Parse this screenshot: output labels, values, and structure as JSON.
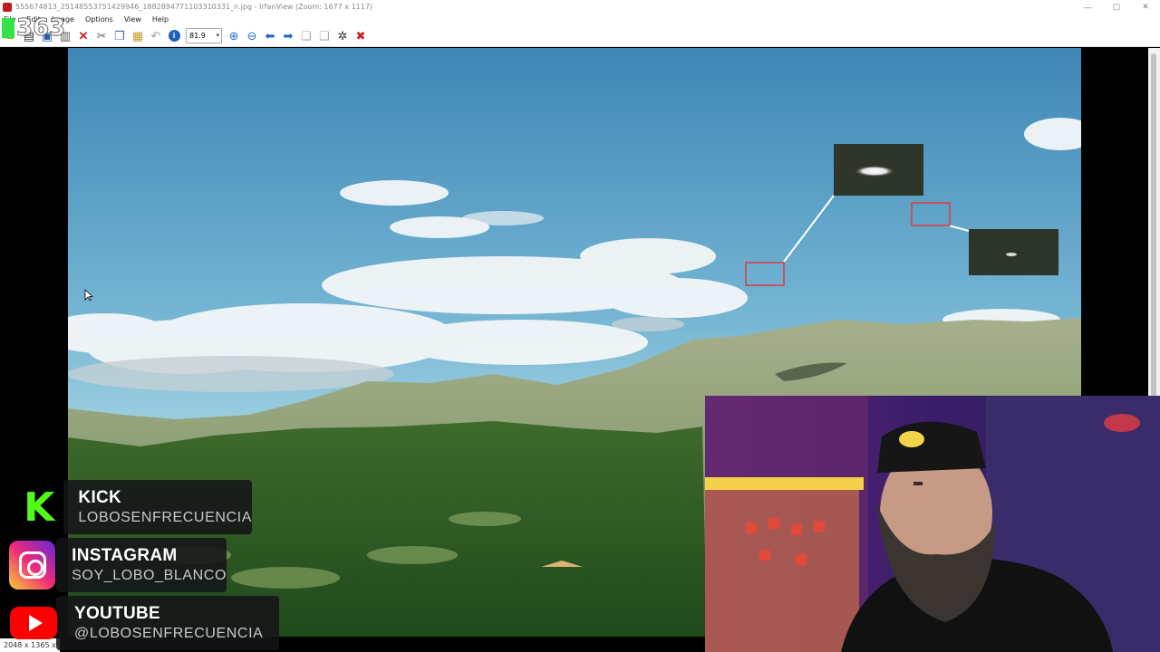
{
  "window": {
    "title": "555674813_25148553751429946_1882894771103310331_n.jpg - IrfanView (Zoom: 1677 x 1117)",
    "controls": {
      "minimize": "—",
      "maximize": "▢",
      "close": "✕"
    }
  },
  "menu": [
    "File",
    "Edit",
    "Image",
    "Options",
    "View",
    "Help"
  ],
  "toolbar": {
    "zoom_value": "81.9",
    "buttons": [
      "open-icon",
      "slideshow-icon",
      "save-icon",
      "print-icon",
      "delete-icon",
      "cut-icon",
      "copy-icon",
      "paste-icon",
      "undo-icon",
      "info-icon",
      "zoom-in-icon",
      "zoom-out-icon",
      "previous-icon",
      "next-icon",
      "first-page-icon",
      "last-page-icon",
      "settings-icon",
      "exit-icon"
    ]
  },
  "overlay_counter": "363",
  "status": {
    "dimensions": "2048 x 1365 x"
  },
  "social": [
    {
      "network": "KICK",
      "handle": "LOBOSENFRECUENCIA",
      "color": "#53fc18"
    },
    {
      "network": "INSTAGRAM",
      "handle": "SOY_LOBO_BLANCO",
      "color": "#ee2a7b"
    },
    {
      "network": "YOUTUBE",
      "handle": "@LOBOSENFRECUENCIA",
      "color": "#ff0000"
    }
  ],
  "colors": {
    "sky_top": "#4a94bf",
    "sky_bottom": "#9fd0e2",
    "highlight_box": "#e0393e"
  }
}
